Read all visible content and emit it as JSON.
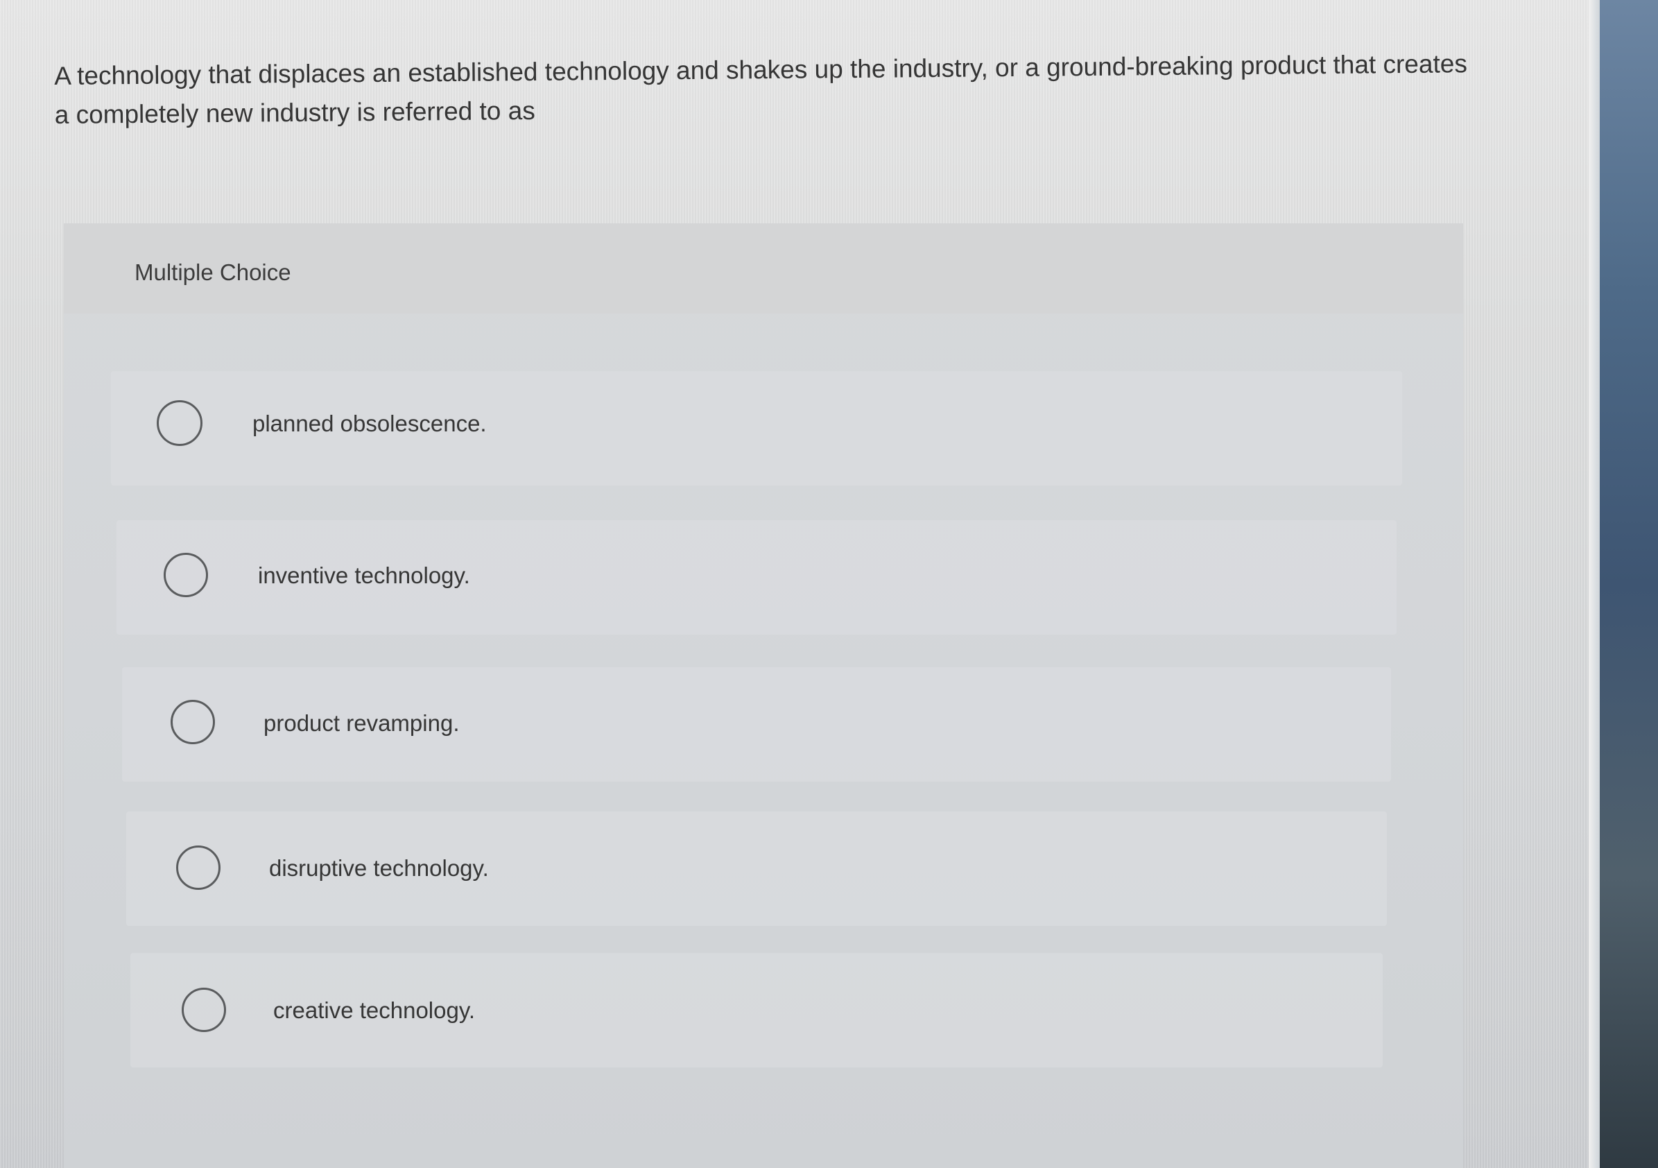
{
  "question": {
    "text": "A technology that displaces an established technology and shakes up the industry, or a ground-breaking product that creates a completely new industry is referred to as"
  },
  "panel": {
    "title": "Multiple Choice"
  },
  "options": [
    {
      "label": "planned obsolescence."
    },
    {
      "label": "inventive technology."
    },
    {
      "label": "product revamping."
    },
    {
      "label": "disruptive technology."
    },
    {
      "label": "creative technology."
    }
  ]
}
